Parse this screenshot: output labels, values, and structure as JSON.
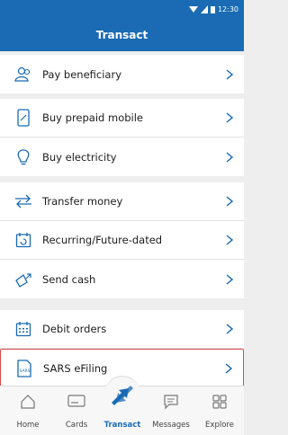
{
  "status": {
    "time": "12:30"
  },
  "header": {
    "title": "Transact"
  },
  "groups": [
    {
      "items": [
        {
          "label": "Pay beneficiary"
        }
      ]
    },
    {
      "items": [
        {
          "label": "Buy prepaid mobile"
        },
        {
          "label": "Buy electricity"
        }
      ]
    },
    {
      "items": [
        {
          "label": "Transfer money"
        },
        {
          "label": "Recurring/Future-dated"
        },
        {
          "label": "Send cash"
        }
      ]
    },
    {
      "items": [
        {
          "label": "Debit orders"
        },
        {
          "label": "SARS eFiling"
        }
      ]
    }
  ],
  "sars_icon_text": "SARS",
  "tabs": [
    {
      "label": "Home"
    },
    {
      "label": "Cards"
    },
    {
      "label": "Transact",
      "active": true
    },
    {
      "label": "Messages"
    },
    {
      "label": "Explore"
    }
  ],
  "colors": {
    "brand": "#1a6bb4",
    "highlight": "#e04a4a"
  }
}
